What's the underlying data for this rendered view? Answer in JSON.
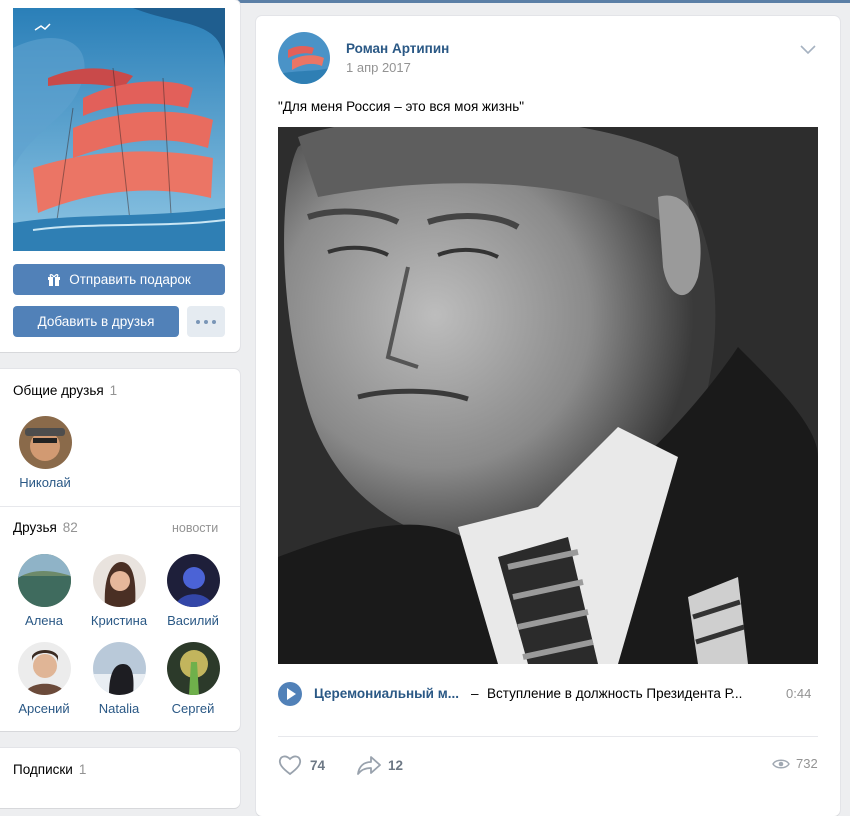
{
  "profile": {
    "gift_button": "Отправить подарок",
    "add_friend_button": "Добавить в друзья"
  },
  "mutual": {
    "title": "Общие друзья",
    "count": "1",
    "friends": [
      {
        "name": "Николай"
      }
    ]
  },
  "friends": {
    "title": "Друзья",
    "count": "82",
    "news_link": "новости",
    "items": [
      {
        "name": "Алена"
      },
      {
        "name": "Кристина"
      },
      {
        "name": "Василий"
      },
      {
        "name": "Арсений"
      },
      {
        "name": "Natalia"
      },
      {
        "name": "Сергей"
      }
    ]
  },
  "subscriptions": {
    "title": "Подписки",
    "count": "1"
  },
  "post": {
    "author": "Роман Артипин",
    "date": "1 апр 2017",
    "text": "\"Для меня Россия – это вся моя жизнь\"",
    "audio": {
      "artist": "Церемониальный м...",
      "dash": "–",
      "title": "Вступление в должность Президента Р...",
      "duration": "0:44"
    },
    "likes": "74",
    "shares": "12",
    "views": "732"
  },
  "colors": {
    "accent": "#5181b8",
    "link": "#2a5885",
    "muted": "#939393",
    "background": "#edeef0"
  }
}
